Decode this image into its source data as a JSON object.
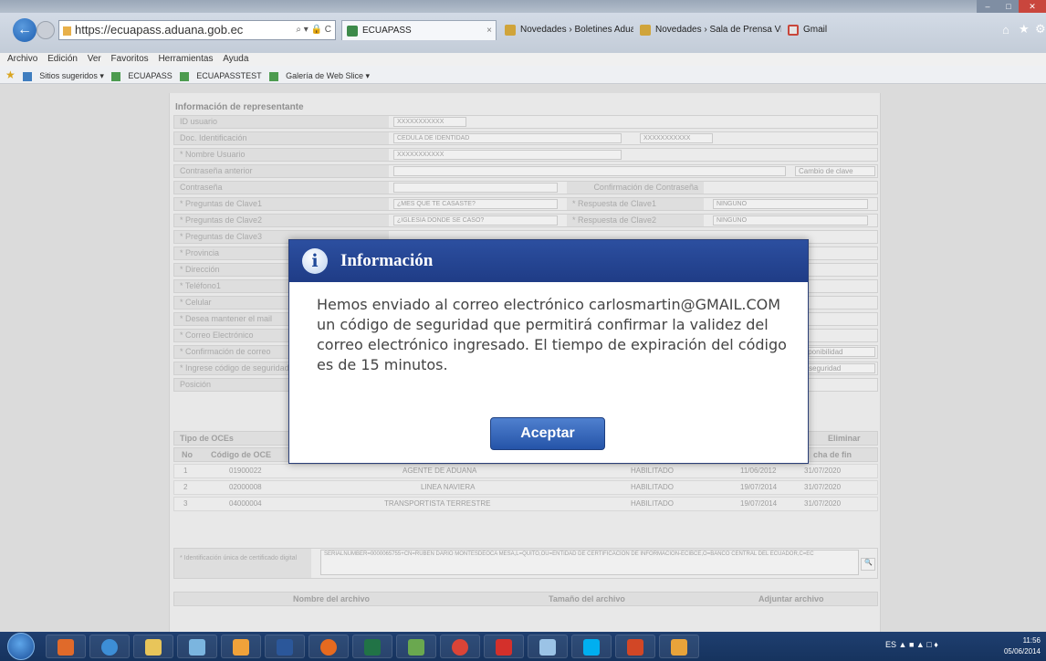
{
  "browser": {
    "url": "https://ecuapass.aduana.gob.ec",
    "url_controls": "⌕ ▾ 🔒 C",
    "tabs": [
      {
        "label": "ECUAPASS",
        "active": true,
        "close": "×"
      },
      {
        "label": "Novedades › Boletines Aduan...",
        "active": false
      },
      {
        "label": "Novedades › Sala de Prensa Vi...",
        "active": false
      },
      {
        "label": "Gmail",
        "active": false
      }
    ],
    "menu": [
      "Archivo",
      "Edición",
      "Ver",
      "Favoritos",
      "Herramientas",
      "Ayuda"
    ],
    "favorites": [
      "Sitios sugeridos ▾",
      "ECUAPASS",
      "ECUAPASSTEST",
      "Galería de Web Slice ▾"
    ]
  },
  "form": {
    "section_title": "Información de representante",
    "rows": [
      {
        "label": "ID usuario",
        "value": "XXXXXXXXXXX"
      },
      {
        "label": "Doc. Identificación",
        "value": "CEDULA DE IDENTIDAD",
        "extra": "XXXXXXXXXXX"
      },
      {
        "label": "* Nombre Usuario",
        "value": "XXXXXXXXXXX"
      },
      {
        "label": "Contraseña anterior",
        "value": "",
        "button": "Cambio de clave"
      },
      {
        "label": "Contraseña",
        "value": "",
        "right_label": "Confirmación de Contraseña"
      },
      {
        "label": "* Preguntas de Clave1",
        "value": "¿MES QUE TE CASASTE?",
        "right_label": "* Respuesta de Clave1",
        "right_value": "NINGUNO"
      },
      {
        "label": "* Preguntas de Clave2",
        "value": "¿IGLESIA DONDE SE CASO?",
        "right_label": "* Respuesta de Clave2",
        "right_value": "NINGUNO"
      },
      {
        "label": "* Preguntas de Clave3",
        "value": ""
      },
      {
        "label": "* Provincia",
        "value": ""
      },
      {
        "label": "* Dirección",
        "value": ""
      },
      {
        "label": "* Teléfono1",
        "value": ""
      },
      {
        "label": "* Celular",
        "value": ""
      },
      {
        "label": "* Desea mantener el mail",
        "value": ""
      },
      {
        "label": "* Correo Electrónico",
        "value": ""
      },
      {
        "label": "* Confirmación de correo",
        "value": "",
        "button": "disponibilidad"
      },
      {
        "label": "* Ingrese código de seguridad",
        "value": "",
        "button": "de seguridad"
      },
      {
        "label": "Posición",
        "value": ""
      }
    ]
  },
  "grid": {
    "toolbar_label": "Tipo de OCEs",
    "delete_button": "Eliminar",
    "headers": [
      "No",
      "Código de OCE",
      "",
      "",
      "",
      "cha de fin"
    ],
    "rows": [
      {
        "no": "1",
        "code": "01900022",
        "type": "AGENTE DE ADUANA",
        "status": "HABILITADO",
        "start": "11/06/2012",
        "end": "31/07/2020"
      },
      {
        "no": "2",
        "code": "02000008",
        "type": "LINEA NAVIERA",
        "status": "HABILITADO",
        "start": "19/07/2014",
        "end": "31/07/2020"
      },
      {
        "no": "3",
        "code": "04000004",
        "type": "TRANSPORTISTA TERRESTRE",
        "status": "HABILITADO",
        "start": "19/07/2014",
        "end": "31/07/2020"
      }
    ]
  },
  "certificate": {
    "label": "* Identificación única de certificado digital",
    "value": "SERIALNUMBER=0000065755+CN=RUBEN DARIO MONTESDEOCA MESA,L=QUITO,OU=ENTIDAD DE CERTIFICACION DE INFORMACION-ECIBCE,O=BANCO CENTRAL DEL ECUADOR,C=EC"
  },
  "files": {
    "headers": [
      "Nombre del archivo",
      "Tamaño del archivo",
      "Adjuntar archivo"
    ]
  },
  "dialog": {
    "title": "Información",
    "message": "Hemos enviado al correo electrónico carlosmartin@GMAIL.COM un código de seguridad que permitirá confirmar la validez del correo electrónico ingresado. El tiempo de expiración del código es de 15 minutos.",
    "button": "Aceptar"
  },
  "taskbar": {
    "time": "11:56",
    "date": "05/06/2014",
    "lang": "ES"
  },
  "colors": {
    "dialog_header": "#2c4fa0",
    "button": "#2554a8"
  }
}
